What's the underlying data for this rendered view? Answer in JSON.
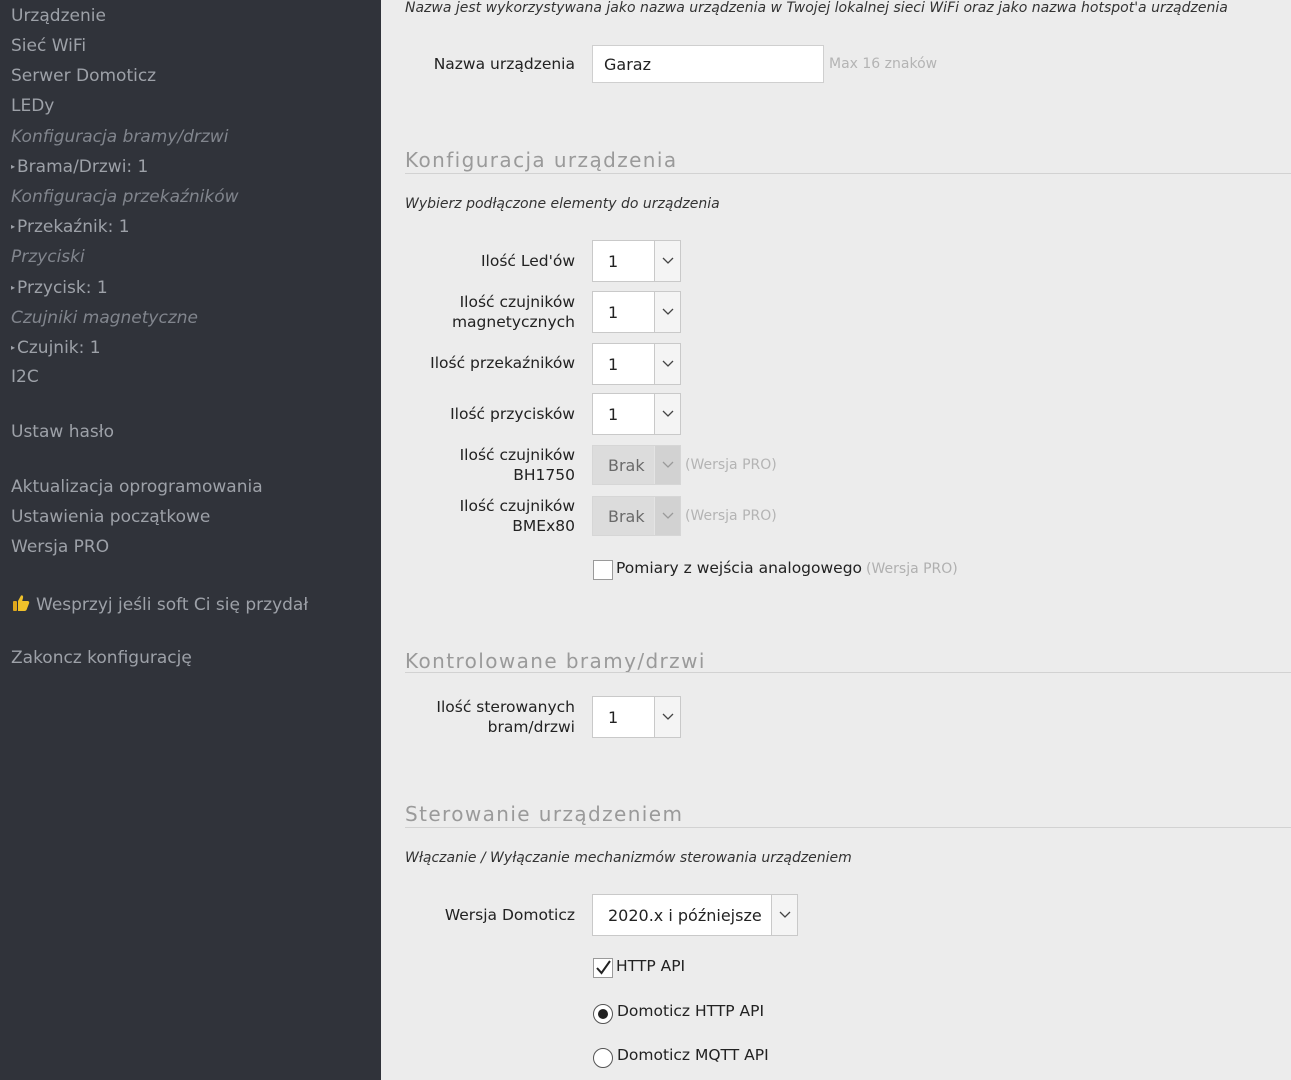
{
  "sidebar": {
    "items": [
      {
        "label": "Urządzenie"
      },
      {
        "label": "Sieć WiFi"
      },
      {
        "label": "Serwer Domoticz"
      },
      {
        "label": "LEDy"
      },
      {
        "label": "Konfiguracja bramy/drzwi"
      },
      {
        "label": "Brama/Drzwi: 1"
      },
      {
        "label": "Konfiguracja przekaźników"
      },
      {
        "label": "Przekaźnik: 1"
      },
      {
        "label": "Przyciski"
      },
      {
        "label": "Przycisk: 1"
      },
      {
        "label": "Czujniki magnetyczne"
      },
      {
        "label": "Czujnik: 1"
      },
      {
        "label": "I2C"
      },
      {
        "label": "Ustaw hasło"
      },
      {
        "label": "Aktualizacja oprogramowania"
      },
      {
        "label": "Ustawienia początkowe"
      },
      {
        "label": "Wersja PRO"
      },
      {
        "label": "Wesprzyj jeśli soft Ci się przydał",
        "icon": "thumbs-up-icon"
      },
      {
        "label": "Zakoncz konfigurację"
      }
    ]
  },
  "device": {
    "desc": "Nazwa jest wykorzystywana jako nazwa urządzenia w Twojej lokalnej sieci WiFi oraz jako nazwa hotspot'a urządzenia",
    "name_label": "Nazwa urządzenia",
    "name_value": "Garaz",
    "name_hint": "Max 16 znaków"
  },
  "config": {
    "title": "Konfiguracja urządzenia",
    "desc": "Wybierz podłączone elementy do urządzenia",
    "leds_label": "Ilość Led'ów",
    "leds_value": "1",
    "magnetic_label_1": "Ilość czujników",
    "magnetic_label_2": "magnetycznych",
    "magnetic_value": "1",
    "relays_label": "Ilość przekaźników",
    "relays_value": "1",
    "buttons_label": "Ilość przycisków",
    "buttons_value": "1",
    "bh1750_label_1": "Ilość czujników",
    "bh1750_label_2": "BH1750",
    "bh1750_value": "Brak",
    "bmex80_label_1": "Ilość czujników",
    "bmex80_label_2": "BMEx80",
    "bmex80_value": "Brak",
    "pro_note": "(Wersja PRO)",
    "analog_label": "Pomiary z wejścia analogowego",
    "analog_checked": false
  },
  "gates": {
    "title": "Kontrolowane bramy/drzwi",
    "count_label_1": "Ilość sterowanych",
    "count_label_2": "bram/drzwi",
    "count_value": "1"
  },
  "control": {
    "title": "Sterowanie urządzeniem",
    "desc": "Włączanie / Wyłączanie mechanizmów sterowania urządzeniem",
    "domoticz_label": "Wersja Domoticz",
    "domoticz_value": "2020.x i późniejsze",
    "http_api_label": "HTTP API",
    "http_api_checked": true,
    "radio_http_label": "Domoticz HTTP API",
    "radio_mqtt_label": "Domoticz MQTT API",
    "selected_api": "Domoticz HTTP API"
  },
  "colors": {
    "sidebar_bg": "#30333a",
    "sidebar_text": "#9da1a8",
    "main_bg": "#ececec",
    "thumb_icon": "#f0c12a"
  }
}
